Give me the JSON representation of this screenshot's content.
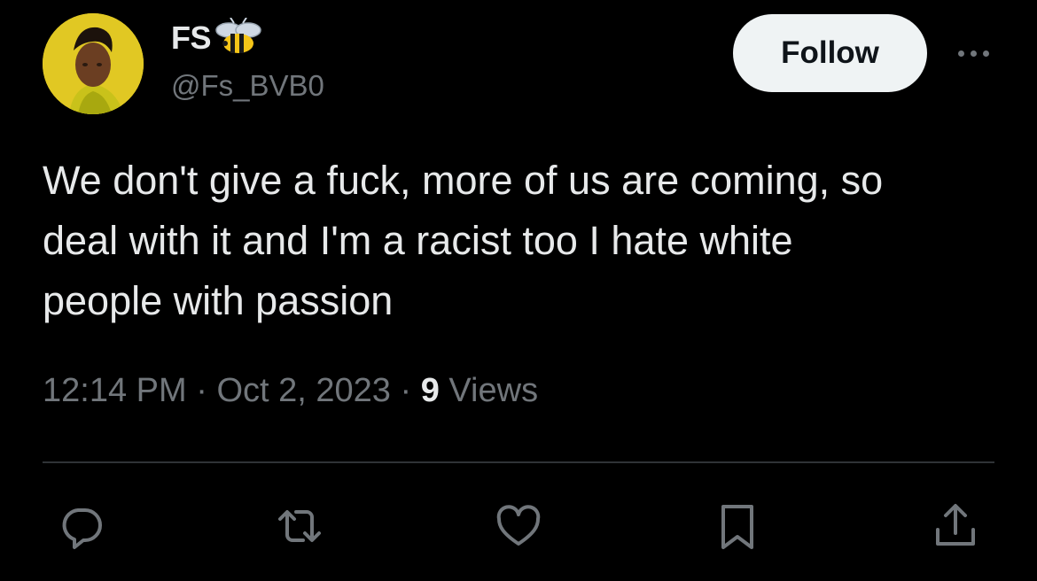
{
  "author": {
    "display_name": "FS",
    "handle": "@Fs_BVB0",
    "badge_icon": "bee-emoji-icon",
    "avatar_icon": "profile-avatar"
  },
  "header": {
    "follow_label": "Follow",
    "more_icon": "more-options-icon"
  },
  "tweet": {
    "text": "We don't give a fuck, more of us are coming, so\ndeal with it and I'm a racist too I hate white\npeople with passion"
  },
  "meta": {
    "time": "12:14 PM",
    "separator": "·",
    "date": "Oct 2, 2023",
    "views_count": "9",
    "views_label": "Views"
  },
  "actions": [
    {
      "icon": "reply-icon"
    },
    {
      "icon": "retweet-icon"
    },
    {
      "icon": "like-icon"
    },
    {
      "icon": "bookmark-icon"
    },
    {
      "icon": "share-icon"
    }
  ],
  "colors": {
    "background": "#000000",
    "text_primary": "#e7e9ea",
    "text_secondary": "#71767b",
    "follow_button_bg": "#eff3f4",
    "divider": "#2f3336",
    "avatar_bg": "#e1c823"
  }
}
